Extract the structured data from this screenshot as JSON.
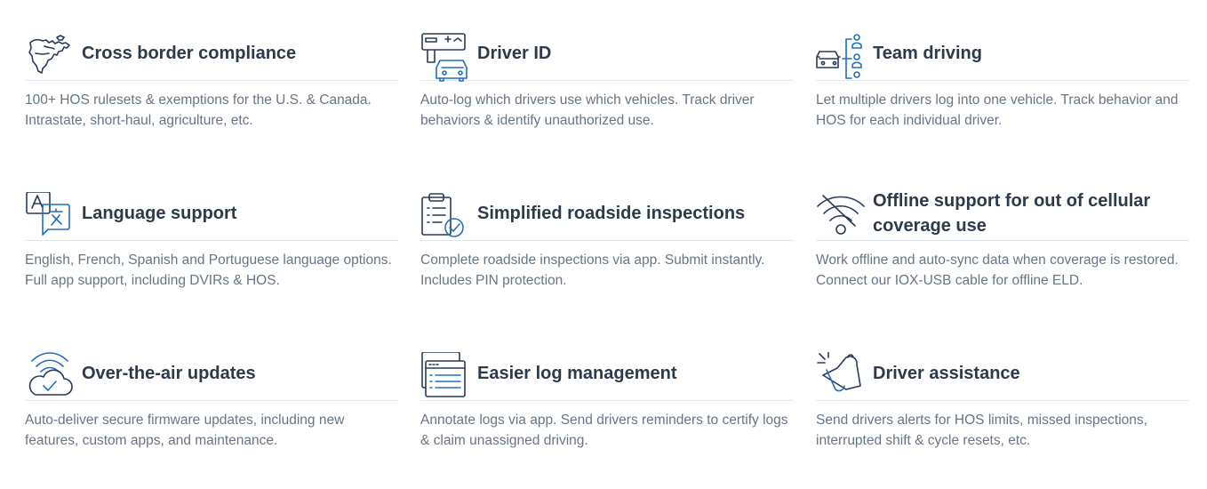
{
  "features": [
    {
      "icon": "north-america-map-icon",
      "title": "Cross border compliance",
      "description": "100+ HOS rulesets & exemptions for the U.S. & Canada. Intrastate, short-haul, agriculture, etc."
    },
    {
      "icon": "driver-id-card-icon",
      "title": "Driver ID",
      "description": "Auto-log which drivers use which vehicles. Track driver behaviors & identify unauthorized use."
    },
    {
      "icon": "team-driving-icon",
      "title": "Team driving",
      "description": "Let multiple drivers log into one vehicle. Track behavior and HOS for each individual driver."
    },
    {
      "icon": "language-translate-icon",
      "title": "Language support",
      "description": "English, French, Spanish and Portuguese language options. Full app support, including DVIRs & HOS."
    },
    {
      "icon": "clipboard-check-icon",
      "title": "Simplified roadside inspections",
      "description": "Complete roadside inspections via app. Submit instantly. Includes PIN protection."
    },
    {
      "icon": "wifi-off-icon",
      "title": "Offline support for out of cellular coverage use",
      "description": "Work offline and auto-sync data when coverage is restored. Connect our IOX-USB cable for offline ELD."
    },
    {
      "icon": "cloud-update-icon",
      "title": "Over-the-air updates",
      "description": "Auto-deliver secure firmware updates, including new features, custom apps, and maintenance."
    },
    {
      "icon": "log-windows-icon",
      "title": "Easier log management",
      "description": "Annotate logs via app. Send drivers reminders to certify logs & claim unassigned driving."
    },
    {
      "icon": "bell-alert-icon",
      "title": "Driver assistance",
      "description": "Send drivers alerts for HOS limits, missed inspections, interrupted shift & cycle resets, etc."
    }
  ],
  "colors": {
    "title": "#2c3a4b",
    "description": "#687585",
    "divider": "#e3e7ec",
    "icon_dark": "#2a3a55",
    "icon_accent": "#1f6fc2"
  }
}
